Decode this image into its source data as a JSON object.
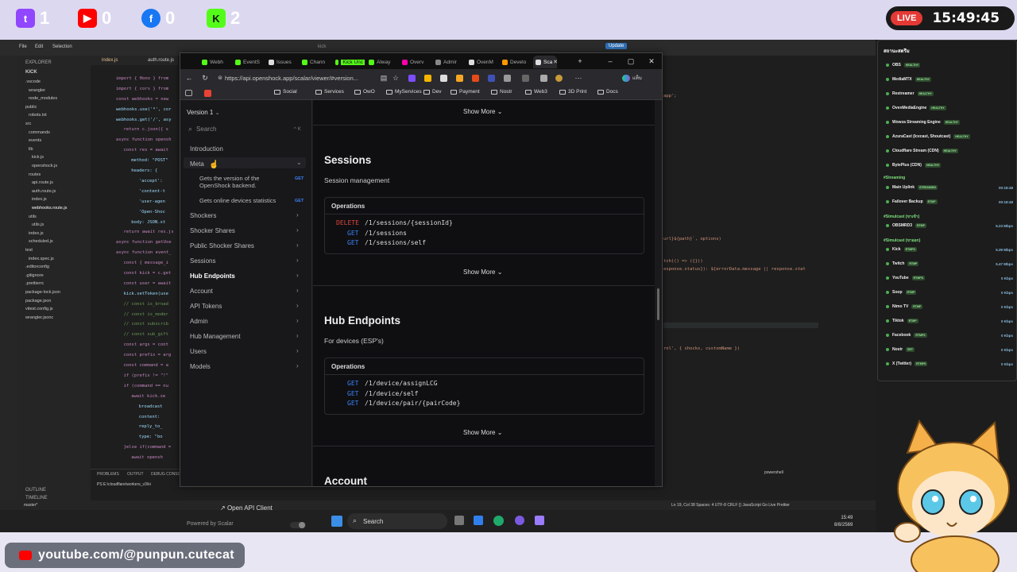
{
  "stream": {
    "social": [
      {
        "name": "twitch-icon",
        "count": "1",
        "color": "#9146ff"
      },
      {
        "name": "youtube-icon",
        "count": "0",
        "color": "#ff0000"
      },
      {
        "name": "facebook-icon",
        "count": "0",
        "color": "#1877f2"
      },
      {
        "name": "kick-icon",
        "count": "2",
        "color": "#53fc18"
      }
    ],
    "live_label": "LIVE",
    "clock": "15:49:45",
    "youtube_handle": "youtube.com/@punpun.cutecat",
    "panel": {
      "title": "สถานะสตรีม",
      "services": [
        {
          "name": "OBS",
          "tag": "HEALTHY"
        },
        {
          "name": "MediaMTX",
          "tag": "HEALTHY"
        },
        {
          "name": "Restreamer",
          "tag": "HEALTHY"
        },
        {
          "name": "OvenMediaEngine",
          "tag": "HEALTHY"
        },
        {
          "name": "Wowza Streaming Engine",
          "tag": "HEALTHY"
        },
        {
          "name": "AzuraCast (Icecast, Shoutcast)",
          "tag": "HEALTHY"
        },
        {
          "name": "Cloudflare Stream (CDN)",
          "tag": "HEALTHY"
        },
        {
          "name": "BytePlus (CDN)",
          "tag": "HEALTHY"
        }
      ],
      "streaming_header": "#Streaming",
      "streaming": [
        {
          "name": "Main Uplink",
          "tag": "STREAMING",
          "value": "00:18:48"
        },
        {
          "name": "Failover Backup",
          "tag": "RTMP",
          "value": "00:18:48"
        }
      ],
      "simulcast_header": "#Simulcast (ขาเข้า)",
      "simulcast_in": [
        {
          "name": "OBSMRD3",
          "tag": "RTMP",
          "value": "6.23 Mbps"
        }
      ],
      "simulcast_out_header": "#Simulcast (ขาออก)",
      "simulcast_out": [
        {
          "name": "Kick",
          "tag": "RTMPS",
          "value": "5.39 Mbps"
        },
        {
          "name": "Twitch",
          "tag": "RTMP",
          "value": "5.47 Mbps"
        },
        {
          "name": "YouTube",
          "tag": "RTMPS",
          "value": "0 Kbps"
        },
        {
          "name": "Soop",
          "tag": "RTMP",
          "value": "0 Kbps"
        },
        {
          "name": "Nimo TV",
          "tag": "RTMP",
          "value": "0 Kbps"
        },
        {
          "name": "Tiktok",
          "tag": "RTMP",
          "value": "0 Kbps"
        },
        {
          "name": "Facebook",
          "tag": "RTMPS",
          "value": "0 Kbps"
        },
        {
          "name": "Nostr",
          "tag": "SRT",
          "value": "0 Kbps"
        },
        {
          "name": "X (Twitter)",
          "tag": "RTMPS",
          "value": "0 Kbps"
        }
      ]
    }
  },
  "vscode": {
    "explorer_title": "EXPLORER",
    "root": "KICK",
    "files": [
      ".vscode",
      "wrangler",
      "node_modules",
      "public",
      "robots.txt",
      "src",
      "commands",
      "events",
      "lib",
      "kick.js",
      "openshock.js",
      "routes",
      "api.route.js",
      "auth.route.js",
      "index.js",
      "webhooks.route.js",
      "utils",
      "utils.js",
      "index.js",
      "scheduled.js",
      "test",
      "index.spec.js",
      ".editorconfig",
      ".gitignore",
      ".prettierrc",
      "package-lock.json",
      "package.json",
      "vitest.config.js",
      "wrangler.jsonc"
    ],
    "tabs": [
      "index.js",
      "auth.route.js"
    ],
    "code_lines": [
      "import { Hono } from",
      "import { cors } from",
      "const webhooks = new",
      "webhooks.use('*', cor",
      "webhooks.get('/', asy",
      "return c.json({ s",
      "async function opensh",
      "const res = await",
      "method: \"POST\"",
      "headers: {",
      "'accept':",
      "'content-t",
      "'user-agen",
      "'Open-Shoc",
      "body: JSON.st",
      "return await res.js",
      "async function getUse",
      "async function event_",
      "const { message_i",
      "const kick = c.get",
      "const user = await",
      "kick.setToken(use",
      "// const is_broad",
      "// const is_moder",
      "// const subscrib",
      "// const sub_gift",
      "const args = cont",
      "const prefix = arg",
      "const command = a",
      "if (prefix != \"!\"",
      "if (command == nu",
      "await kick.se",
      "broadcast",
      "content:",
      "reply_to_",
      "type: \"bo",
      "}else if(command =",
      "await opensh"
    ],
    "right_code": [
      "app';",
      "url}${path}`, options)",
      "tch(() => ({}))",
      "esponse.status}): ${errorData.message || response.stat",
      "rol', { shocks, customName })"
    ],
    "panel_tabs": [
      "PROBLEMS",
      "OUTPUT",
      "DEBUG CONSOLE"
    ],
    "terminal_line": "PS E:\\cloudflare\\workers_v3\\ki",
    "outline": "OUTLINE",
    "timeline": "TIMELINE",
    "status_left": "master*",
    "status_right": "Ln 19, Col 38   Spaces: 4   UTF-8   CRLF   {} JavaScript   Go Live   Prettier",
    "shell": "powershell",
    "update_label": "Update",
    "search_title": "kick"
  },
  "taskbar": {
    "search_label": "Search",
    "time": "15:49",
    "date": "8/8/2569"
  },
  "browser": {
    "tabs": [
      "Webh",
      "EventS",
      "Issues",
      "Chann",
      "Kick Unc",
      "Alway",
      "Overv",
      "Admir",
      "OvenM",
      "Develo",
      "Sca"
    ],
    "url": "https://api.openshock.app/scalar/viewer/#version...",
    "bookmarks": [
      "Social",
      "Services",
      "OwO",
      "MyServices",
      "Dev",
      "Payment",
      "Nostr",
      "Web3",
      "3D Print",
      "Docs"
    ],
    "profile_label": "แท็บ"
  },
  "docs": {
    "version_label": "Version 1",
    "search_placeholder": "Search",
    "search_kbd": "^ K",
    "nav": {
      "introduction": "Introduction",
      "meta": "Meta",
      "meta_ops": [
        {
          "label": "Gets the version of the OpenShock backend.",
          "method": "GET"
        },
        {
          "label": "Gets online devices statistics",
          "method": "GET"
        }
      ],
      "items": [
        "Shockers",
        "Shocker Shares",
        "Public Shocker Shares",
        "Sessions",
        "Hub Endpoints",
        "Account",
        "API Tokens",
        "Admin",
        "Hub Management",
        "Users",
        "Models"
      ],
      "active": "Hub Endpoints"
    },
    "open_api_client": "Open API Client",
    "powered_by": "Powered by Scalar",
    "show_more": "Show More",
    "operations_label": "Operations",
    "sessions": {
      "title": "Sessions",
      "subtitle": "Session management",
      "routes": [
        {
          "method": "DELETE",
          "path": "/1/sessions/{sessionId}"
        },
        {
          "method": "GET",
          "path": "/1/sessions"
        },
        {
          "method": "GET",
          "path": "/1/sessions/self"
        }
      ]
    },
    "hub": {
      "title": "Hub Endpoints",
      "subtitle": "For devices (ESP's)",
      "routes": [
        {
          "method": "GET",
          "path": "/1/device/assignLCG"
        },
        {
          "method": "GET",
          "path": "/1/device/self"
        },
        {
          "method": "GET",
          "path": "/1/device/pair/{pairCode}"
        }
      ]
    },
    "account_title": "Account"
  }
}
